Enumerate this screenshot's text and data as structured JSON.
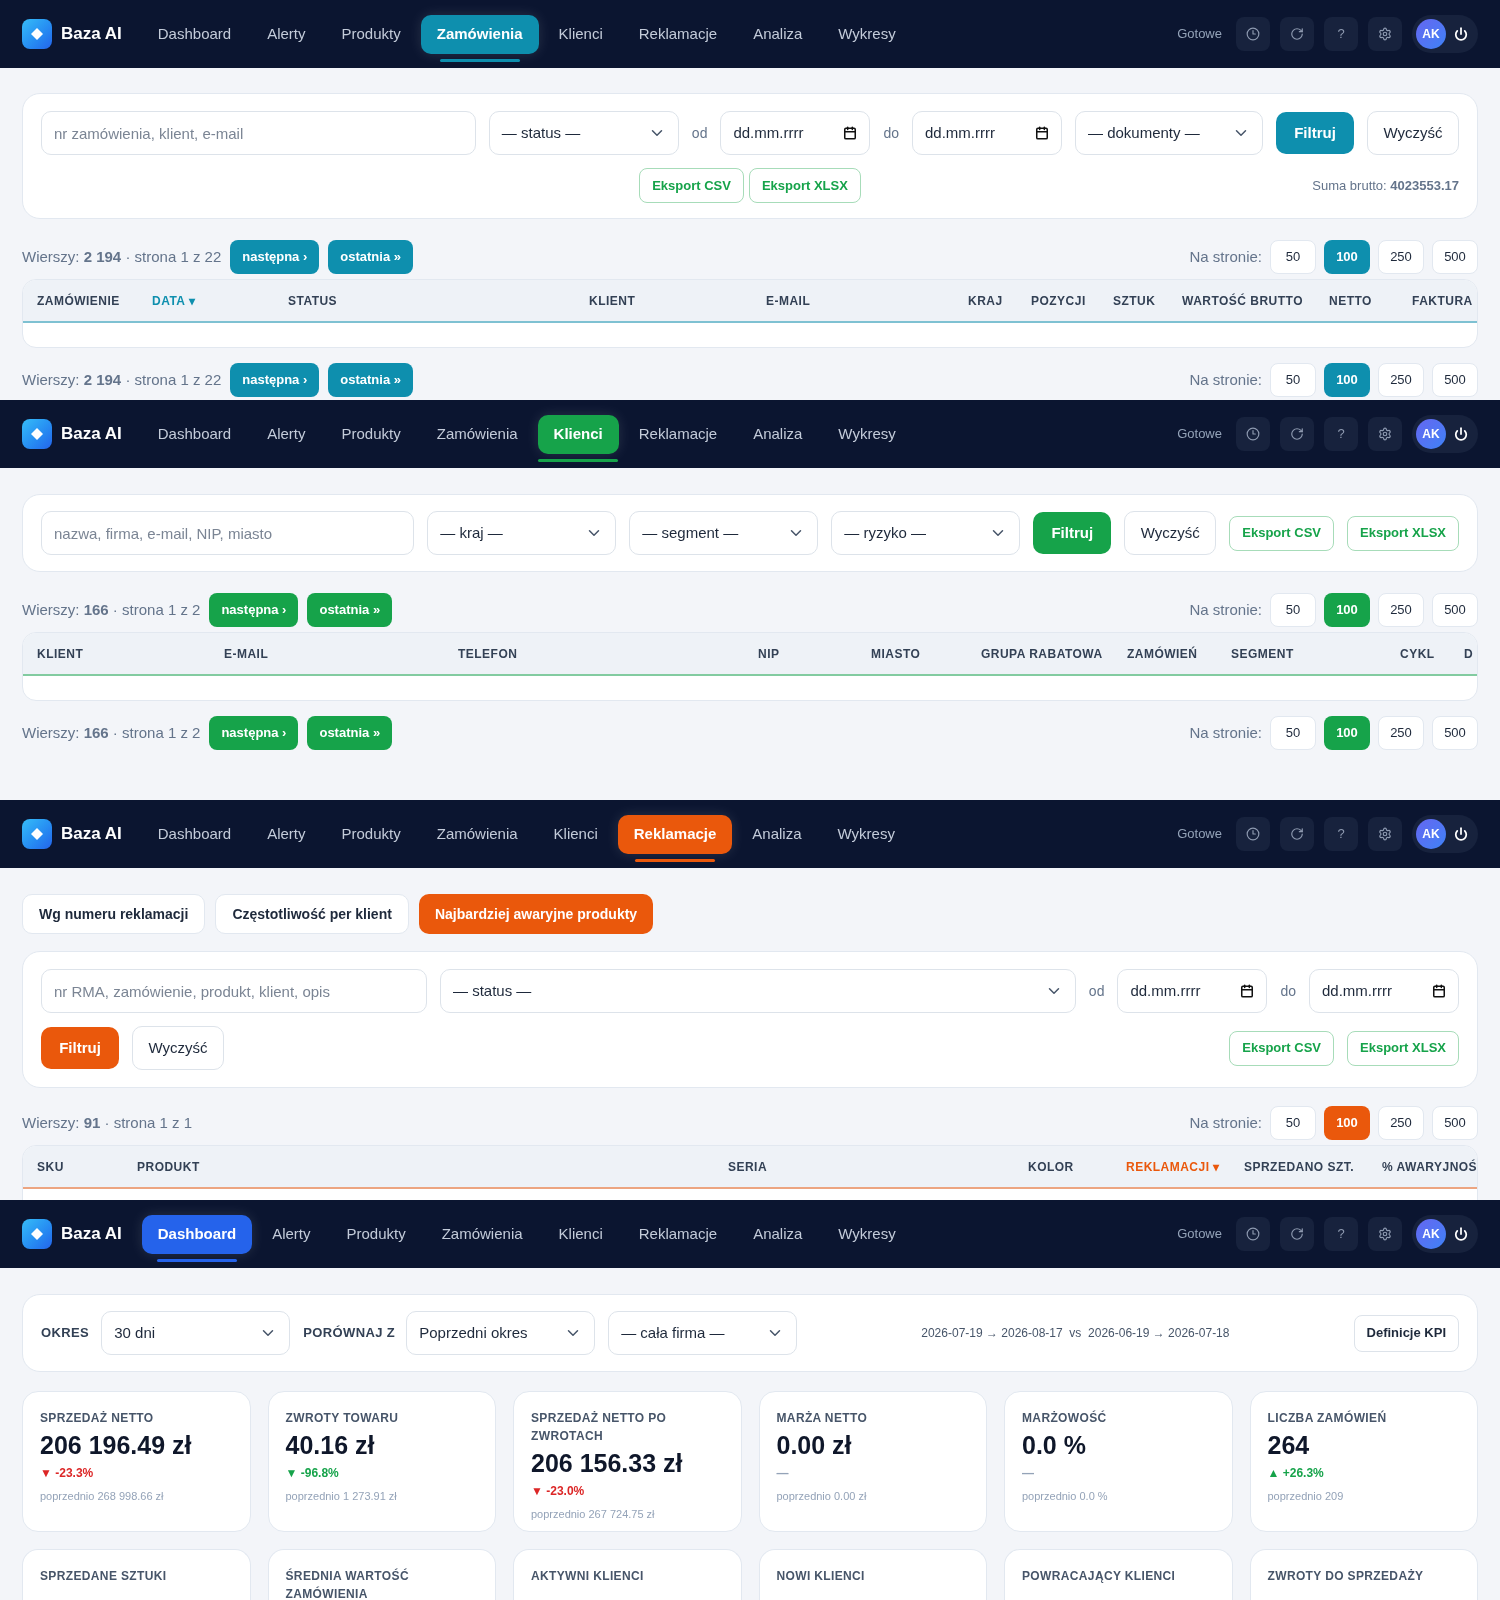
{
  "screens": [
    {
      "kind": "orders",
      "color": "#0e8fae",
      "app": {
        "logo": "Baza AI",
        "nav": [
          {
            "label": "Dashboard",
            "selected": false
          },
          {
            "label": "Alerty",
            "selected": false
          },
          {
            "label": "Produkty",
            "selected": false
          },
          {
            "label": "Zamówienia",
            "selected": true
          },
          {
            "label": "Klienci",
            "selected": false
          },
          {
            "label": "Reklamacje",
            "selected": false
          },
          {
            "label": "Analiza",
            "selected": false
          },
          {
            "label": "Wykresy",
            "selected": false
          }
        ],
        "status": "Gotowe",
        "help": "?",
        "avatar": "AK"
      },
      "filter": {
        "search": {
          "placeholder": "nr zamówienia, klient, e-mail"
        },
        "selects": [
          "— status —"
        ],
        "date_from": {
          "label": "od",
          "value": "dd.mm.rrrr"
        },
        "date_to": {
          "label": "do",
          "value": "dd.mm.rrrr"
        },
        "extra_selects": [
          "— dokumenty —"
        ],
        "filter_button": "Filtruj",
        "clear_button": "Wyczyść",
        "exports": [
          "Eksport CSV",
          "Eksport XLSX"
        ],
        "sum": "Suma brutto: **4023553.17**"
      },
      "pagers": [
        {
          "rows": "Wierszy: **2 194** · strona 1 z 22",
          "next": "następna ›",
          "last": "ostatnia »",
          "per_page_label": "Na stronie:",
          "per_page": [
            {
              "label": "50",
              "selected": false
            },
            {
              "label": "100",
              "selected": true
            },
            {
              "label": "250",
              "selected": false
            },
            {
              "label": "500",
              "selected": false
            }
          ]
        },
        {
          "rows": "Wierszy: **2 194** · strona 1 z 22",
          "next": "następna ›",
          "last": "ostatnia »",
          "per_page_label": "Na stronie:",
          "per_page": [
            {
              "label": "50",
              "selected": false
            },
            {
              "label": "100",
              "selected": true
            },
            {
              "label": "250",
              "selected": false
            },
            {
              "label": "500",
              "selected": false
            }
          ]
        }
      ],
      "table": {
        "columns": [
          {
            "label": "ZAMÓWIENIE",
            "sorted": false
          },
          {
            "label": "DATA ▾",
            "sorted": true
          },
          {
            "label": "STATUS",
            "sorted": false
          },
          {
            "label": "KLIENT",
            "sorted": false
          },
          {
            "label": "E-MAIL",
            "sorted": false
          },
          {
            "label": "KRAJ",
            "sorted": false
          },
          {
            "label": "POZYCJI",
            "sorted": false
          },
          {
            "label": "SZTUK",
            "sorted": false
          },
          {
            "label": "WARTOŚĆ BRUTTO",
            "sorted": false
          },
          {
            "label": "NETTO",
            "sorted": false
          },
          {
            "label": "FAKTURA",
            "sorted": false
          }
        ]
      }
    },
    {
      "kind": "clients",
      "color": "#16a34a",
      "app": {
        "logo": "Baza AI",
        "nav": [
          {
            "label": "Dashboard",
            "selected": false
          },
          {
            "label": "Alerty",
            "selected": false
          },
          {
            "label": "Produkty",
            "selected": false
          },
          {
            "label": "Zamówienia",
            "selected": false
          },
          {
            "label": "Klienci",
            "selected": true
          },
          {
            "label": "Reklamacje",
            "selected": false
          },
          {
            "label": "Analiza",
            "selected": false
          },
          {
            "label": "Wykresy",
            "selected": false
          }
        ],
        "status": "Gotowe",
        "help": "?",
        "avatar": "AK"
      },
      "filter": {
        "search": {
          "placeholder": "nazwa, firma, e-mail, NIP, miasto"
        },
        "selects": [
          "— kraj —",
          "— segment —",
          "— ryzyko —"
        ],
        "filter_button": "Filtruj",
        "clear_button": "Wyczyść",
        "exports": [
          "Eksport CSV",
          "Eksport XLSX"
        ]
      },
      "pagers": [
        {
          "rows": "Wierszy: **166** · strona 1 z 2",
          "next": "następna ›",
          "last": "ostatnia »",
          "per_page_label": "Na stronie:",
          "per_page": [
            {
              "label": "50",
              "selected": false
            },
            {
              "label": "100",
              "selected": true
            },
            {
              "label": "250",
              "selected": false
            },
            {
              "label": "500",
              "selected": false
            }
          ]
        },
        {
          "rows": "Wierszy: **166** · strona 1 z 2",
          "next": "następna ›",
          "last": "ostatnia »",
          "per_page_label": "Na stronie:",
          "per_page": [
            {
              "label": "50",
              "selected": false
            },
            {
              "label": "100",
              "selected": true
            },
            {
              "label": "250",
              "selected": false
            },
            {
              "label": "500",
              "selected": false
            }
          ]
        }
      ],
      "table": {
        "columns": [
          {
            "label": "KLIENT",
            "sorted": false
          },
          {
            "label": "E-MAIL",
            "sorted": false
          },
          {
            "label": "TELEFON",
            "sorted": false
          },
          {
            "label": "NIP",
            "sorted": false
          },
          {
            "label": "MIASTO",
            "sorted": false
          },
          {
            "label": "GRUPA RABATOWA",
            "sorted": false
          },
          {
            "label": "ZAMÓWIEŃ",
            "sorted": false
          },
          {
            "label": "SEGMENT",
            "sorted": false
          },
          {
            "label": "CYKL",
            "sorted": false
          },
          {
            "label": "D",
            "sorted": false
          }
        ]
      }
    },
    {
      "kind": "complaints",
      "color": "#ea580c",
      "app": {
        "logo": "Baza AI",
        "nav": [
          {
            "label": "Dashboard",
            "selected": false
          },
          {
            "label": "Alerty",
            "selected": false
          },
          {
            "label": "Produkty",
            "selected": false
          },
          {
            "label": "Zamówienia",
            "selected": false
          },
          {
            "label": "Klienci",
            "selected": false
          },
          {
            "label": "Reklamacje",
            "selected": true
          },
          {
            "label": "Analiza",
            "selected": false
          },
          {
            "label": "Wykresy",
            "selected": false
          }
        ],
        "status": "Gotowe",
        "help": "?",
        "avatar": "AK"
      },
      "subtabs": [
        {
          "label": "Wg numeru reklamacji",
          "selected": false
        },
        {
          "label": "Częstotliwość per klient",
          "selected": false
        },
        {
          "label": "Najbardziej awaryjne produkty",
          "selected": true
        }
      ],
      "filter": {
        "search": {
          "placeholder": "nr RMA, zamówienie, produkt, klient, opis"
        },
        "selects": [
          "— status —"
        ],
        "date_from": {
          "label": "od",
          "value": "dd.mm.rrrr"
        },
        "date_to": {
          "label": "do",
          "value": "dd.mm.rrrr"
        },
        "filter_button": "Filtruj",
        "clear_button": "Wyczyść",
        "exports": [
          "Eksport CSV",
          "Eksport XLSX"
        ]
      },
      "pagers": [
        {
          "rows": "Wierszy: **91** · strona 1 z 1",
          "per_page_label": "Na stronie:",
          "per_page": [
            {
              "label": "50",
              "selected": false
            },
            {
              "label": "100",
              "selected": true
            },
            {
              "label": "250",
              "selected": false
            },
            {
              "label": "500",
              "selected": false
            }
          ]
        }
      ],
      "table": {
        "columns": [
          {
            "label": "SKU",
            "sorted": false
          },
          {
            "label": "PRODUKT",
            "sorted": false
          },
          {
            "label": "SERIA",
            "sorted": false
          },
          {
            "label": "KOLOR",
            "sorted": false
          },
          {
            "label": "REKLAMACJI ▾",
            "sorted": true
          },
          {
            "label": "SPRZEDANO SZT.",
            "sorted": false
          },
          {
            "label": "% AWARYJNOŚ",
            "sorted": false
          }
        ]
      }
    },
    {
      "kind": "dashboard",
      "color": "#2563eb",
      "app": {
        "logo": "Baza AI",
        "nav": [
          {
            "label": "Dashboard",
            "selected": true
          },
          {
            "label": "Alerty",
            "selected": false
          },
          {
            "label": "Produkty",
            "selected": false
          },
          {
            "label": "Zamówienia",
            "selected": false
          },
          {
            "label": "Klienci",
            "selected": false
          },
          {
            "label": "Reklamacje",
            "selected": false
          },
          {
            "label": "Analiza",
            "selected": false
          },
          {
            "label": "Wykresy",
            "selected": false
          }
        ],
        "status": "Gotowe",
        "help": "?",
        "avatar": "AK"
      },
      "controls": {
        "period_label": "OKRES",
        "period": "30 dni",
        "compare_label": "PORÓWNAJ Z",
        "compare": "Poprzedni okres",
        "scope": "— cała firma —",
        "range": "2026-07-19 → 2026-08-17  vs  2026-06-19 → 2026-07-18",
        "kpi_button": "Definicje KPI"
      },
      "kpis": [
        {
          "title": "SPRZEDAŻ NETTO",
          "value": "206 196.49 zł",
          "delta": {
            "text": "▼ -23.3%",
            "color": "#dc2626"
          },
          "previous": "poprzednio 268 998.66 zł"
        },
        {
          "title": "ZWROTY TOWARU",
          "value": "40.16 zł",
          "delta": {
            "text": "▼ -96.8%",
            "color": "#16a34a"
          },
          "previous": "poprzednio 1 273.91 zł"
        },
        {
          "title": "SPRZEDAŻ NETTO PO ZWROTACH",
          "value": "206 156.33 zł",
          "delta": {
            "text": "▼ -23.0%",
            "color": "#dc2626"
          },
          "previous": "poprzednio 267 724.75 zł"
        },
        {
          "title": "MARŻA NETTO",
          "value": "0.00 zł",
          "delta": {
            "text": "—",
            "color": "#94a3b8"
          },
          "previous": "poprzednio 0.00 zł"
        },
        {
          "title": "MARŻOWOŚĆ",
          "value": "0.0 %",
          "delta": {
            "text": "—",
            "color": "#94a3b8"
          },
          "previous": "poprzednio 0.0 %"
        },
        {
          "title": "LICZBA ZAMÓWIEŃ",
          "value": "264",
          "delta": {
            "text": "▲ +26.3%",
            "color": "#16a34a"
          },
          "previous": "poprzednio 209"
        }
      ],
      "kpis_more": [
        {
          "title": "SPRZEDANE SZTUKI"
        },
        {
          "title": "ŚREDNIA WARTOŚĆ ZAMÓWIENIA"
        },
        {
          "title": "AKTYWNI KLIENCI"
        },
        {
          "title": "NOWI KLIENCI"
        },
        {
          "title": "POWRACAJĄCY KLIENCI"
        },
        {
          "title": "ZWROTY DO SPRZEDAŻY"
        }
      ]
    }
  ]
}
